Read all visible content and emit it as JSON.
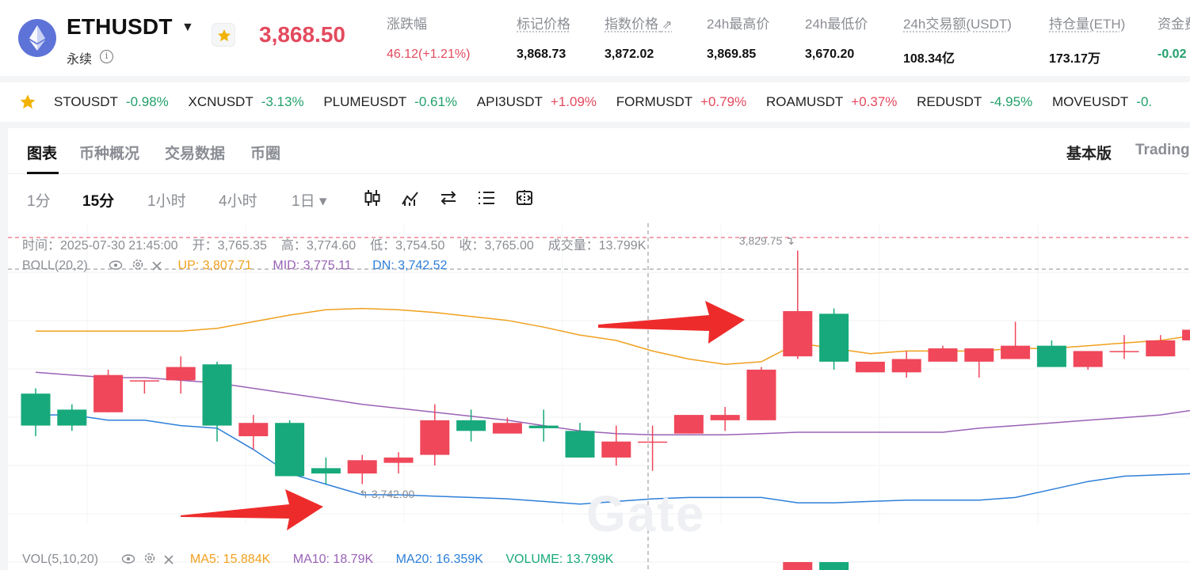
{
  "header": {
    "symbol": "ETHUSDT",
    "contract_type": "永续",
    "last_price": "3,868.50",
    "stats": [
      {
        "label": "涨跌幅",
        "value": "46.12(+1.21%)",
        "tone": "red"
      },
      {
        "label": "标记价格",
        "value": "3,868.73",
        "tone": "normal"
      },
      {
        "label": "指数价格",
        "value": "3,872.02",
        "tone": "normal"
      },
      {
        "label": "24h最高价",
        "value": "3,869.85",
        "tone": "normal"
      },
      {
        "label": "24h最低价",
        "value": "3,670.20",
        "tone": "normal"
      },
      {
        "label": "24h交易额(USDT)",
        "value": "108.34亿",
        "tone": "normal"
      },
      {
        "label": "持仓量(ETH)",
        "value": "173.17万",
        "tone": "normal"
      },
      {
        "label": "资金费",
        "value": "-0.02",
        "tone": "green"
      }
    ]
  },
  "ticker": [
    {
      "name": "STOUSDT",
      "change": "-0.98%",
      "dir": "dn"
    },
    {
      "name": "XCNUSDT",
      "change": "-3.13%",
      "dir": "dn"
    },
    {
      "name": "PLUMEUSDT",
      "change": "-0.61%",
      "dir": "dn"
    },
    {
      "name": "API3USDT",
      "change": "+1.09%",
      "dir": "up"
    },
    {
      "name": "FORMUSDT",
      "change": "+0.79%",
      "dir": "up"
    },
    {
      "name": "ROAMUSDT",
      "change": "+0.37%",
      "dir": "up"
    },
    {
      "name": "REDUSDT",
      "change": "-4.95%",
      "dir": "dn"
    },
    {
      "name": "MOVEUSDT",
      "change": "-0.",
      "dir": "dn"
    }
  ],
  "tabs": [
    "图表",
    "币种概况",
    "交易数据",
    "币圈"
  ],
  "versions": [
    "基本版",
    "Trading"
  ],
  "intervals": [
    "1分",
    "15分",
    "1小时",
    "4小时",
    "1日 ▾"
  ],
  "chart": {
    "ohlc": [
      "时间：2025-07-30 21:45:00",
      "开：3,765.35",
      "高：3,774.60",
      "低：3,754.50",
      "收：3,765.00",
      "成交量：13.799K"
    ],
    "boll_name": "BOLL(20,2)",
    "boll_up": "UP: 3,807.71",
    "boll_mid": "MID: 3,775.11",
    "boll_dn": "DN: 3,742.52",
    "vol_name": "VOL(5,10,20)",
    "ma5": "MA5: 15.884K",
    "ma10": "MA10: 18.79K",
    "ma20": "MA20: 16.359K",
    "volume": "VOLUME: 13.799K",
    "high_label": "3,829.75",
    "low_label": "3,742.00",
    "watermark": "Gate",
    "colors": {
      "up": "#f0475a",
      "down": "#17a97b",
      "upper": "#f0a01d",
      "mid": "#9a62b5",
      "lower": "#2d7fd9",
      "arrow": "#ee2b2b"
    },
    "candles": [
      {
        "o": 3776,
        "c": 3764,
        "h": 3778,
        "l": 3760
      },
      {
        "o": 3770,
        "c": 3764,
        "h": 3772,
        "l": 3762
      },
      {
        "o": 3769,
        "c": 3783,
        "h": 3785,
        "l": 3769
      },
      {
        "o": 3781,
        "c": 3781,
        "h": 3781,
        "l": 3776
      },
      {
        "o": 3781,
        "c": 3786,
        "h": 3790,
        "l": 3776
      },
      {
        "o": 3787,
        "c": 3764,
        "h": 3788,
        "l": 3758
      },
      {
        "o": 3760,
        "c": 3765,
        "h": 3768,
        "l": 3755
      },
      {
        "o": 3765,
        "c": 3745,
        "h": 3766,
        "l": 3745
      },
      {
        "o": 3748,
        "c": 3746,
        "h": 3752,
        "l": 3742
      },
      {
        "o": 3746,
        "c": 3751,
        "h": 3753,
        "l": 3742
      },
      {
        "o": 3750,
        "c": 3752,
        "h": 3754,
        "l": 3746
      },
      {
        "o": 3753,
        "c": 3766,
        "h": 3772,
        "l": 3749
      },
      {
        "o": 3766,
        "c": 3762,
        "h": 3770,
        "l": 3758
      },
      {
        "o": 3761,
        "c": 3765,
        "h": 3767,
        "l": 3761
      },
      {
        "o": 3764,
        "c": 3763,
        "h": 3770,
        "l": 3758
      },
      {
        "o": 3762,
        "c": 3752,
        "h": 3765,
        "l": 3752
      },
      {
        "o": 3752,
        "c": 3758,
        "h": 3764,
        "l": 3749
      },
      {
        "o": 3758,
        "c": 3758,
        "h": 3764,
        "l": 3747
      },
      {
        "o": 3761,
        "c": 3768,
        "h": 3768,
        "l": 3761
      },
      {
        "o": 3766,
        "c": 3768,
        "h": 3771,
        "l": 3762
      },
      {
        "o": 3766,
        "c": 3785,
        "h": 3786,
        "l": 3766
      },
      {
        "o": 3790,
        "c": 3807,
        "h": 3829.75,
        "l": 3789
      },
      {
        "o": 3806,
        "c": 3788,
        "h": 3808,
        "l": 3785
      },
      {
        "o": 3784,
        "c": 3788,
        "h": 3788,
        "l": 3784
      },
      {
        "o": 3784,
        "c": 3789,
        "h": 3792,
        "l": 3782
      },
      {
        "o": 3788,
        "c": 3793,
        "h": 3794,
        "l": 3788
      },
      {
        "o": 3788,
        "c": 3793,
        "h": 3793,
        "l": 3782
      },
      {
        "o": 3789,
        "c": 3794,
        "h": 3803,
        "l": 3789
      },
      {
        "o": 3794,
        "c": 3786,
        "h": 3796,
        "l": 3786
      },
      {
        "o": 3786,
        "c": 3792,
        "h": 3792,
        "l": 3785
      },
      {
        "o": 3792,
        "c": 3792,
        "h": 3798,
        "l": 3789
      },
      {
        "o": 3790,
        "c": 3796,
        "h": 3798,
        "l": 3790
      },
      {
        "o": 3796,
        "c": 3800,
        "h": 3803,
        "l": 3793
      }
    ],
    "upper": [
      3799.5,
      3799.5,
      3799.5,
      3799.5,
      3799.5,
      3800.5,
      3803,
      3805.5,
      3807.5,
      3808,
      3807.5,
      3806.5,
      3805,
      3803.5,
      3801,
      3798,
      3796,
      3792,
      3789,
      3787,
      3788,
      3795,
      3793,
      3791,
      3792,
      3792,
      3792,
      3793,
      3793,
      3794,
      3795,
      3796,
      3798
    ],
    "middle": [
      3784,
      3783,
      3782,
      3782,
      3781,
      3780,
      3778,
      3776,
      3774,
      3772,
      3770.5,
      3769,
      3767.5,
      3766,
      3764,
      3762,
      3761,
      3760.5,
      3760.5,
      3760.5,
      3761,
      3761.5,
      3761.5,
      3761.5,
      3761.5,
      3761.5,
      3763,
      3764,
      3765,
      3766,
      3767,
      3768,
      3770
    ],
    "lower": [
      3768,
      3768,
      3766,
      3766,
      3764,
      3763,
      3755,
      3746,
      3742,
      3738,
      3738,
      3737.5,
      3737,
      3736.5,
      3735.5,
      3734.5,
      3735.5,
      3736.5,
      3737,
      3737,
      3737,
      3735,
      3735,
      3735.5,
      3736,
      3736,
      3736,
      3737,
      3740,
      3743,
      3745,
      3745.5,
      3746
    ]
  }
}
